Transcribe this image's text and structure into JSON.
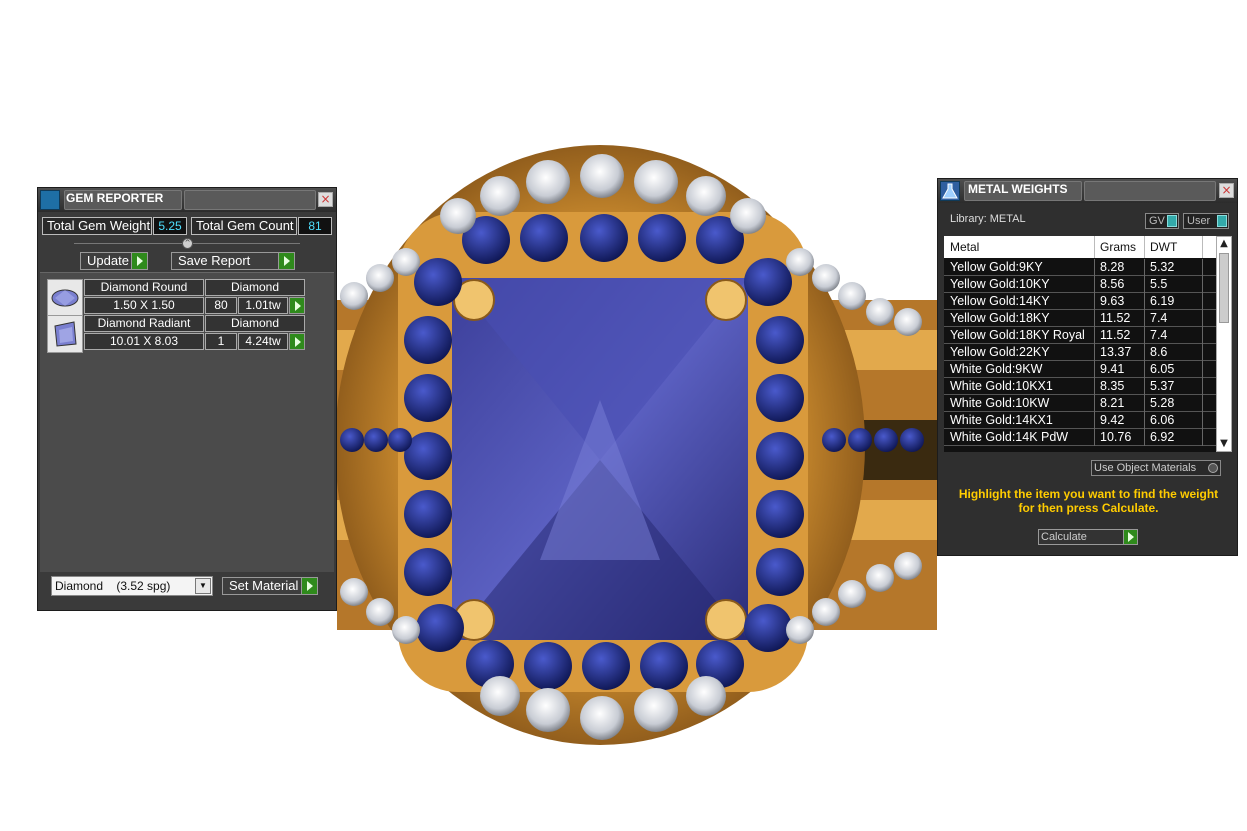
{
  "gem_reporter": {
    "title": "GEM REPORTER",
    "total_gem_weight_label": "Total Gem Weight",
    "total_gem_weight_value": "5.25",
    "total_gem_count_label": "Total Gem Count",
    "total_gem_count_value": "81",
    "update_label": "Update",
    "save_report_label": "Save Report",
    "gems": [
      {
        "name": "Diamond Round",
        "material": "Diamond",
        "size": "1.50 X 1.50",
        "count": "80",
        "weight": "1.01tw"
      },
      {
        "name": "Diamond Radiant",
        "material": "Diamond",
        "size": "10.01 X 8.03",
        "count": "1",
        "weight": "4.24tw"
      }
    ],
    "material_select_value": "Diamond    (3.52 spg)",
    "set_material_label": "Set Material"
  },
  "metal_weights": {
    "title": "METAL WEIGHTS",
    "library_label": "Library: METAL",
    "gv_toggle": "GV",
    "user_toggle": "User",
    "columns": [
      "Metal",
      "Grams",
      "DWT"
    ],
    "rows": [
      {
        "metal": "Yellow Gold:9KY",
        "grams": "8.28",
        "dwt": "5.32"
      },
      {
        "metal": "Yellow Gold:10KY",
        "grams": "8.56",
        "dwt": "5.5"
      },
      {
        "metal": "Yellow Gold:14KY",
        "grams": "9.63",
        "dwt": "6.19"
      },
      {
        "metal": "Yellow Gold:18KY",
        "grams": "11.52",
        "dwt": "7.4"
      },
      {
        "metal": "Yellow Gold:18KY Royal",
        "grams": "11.52",
        "dwt": "7.4"
      },
      {
        "metal": "Yellow Gold:22KY",
        "grams": "13.37",
        "dwt": "8.6"
      },
      {
        "metal": "White Gold:9KW",
        "grams": "9.41",
        "dwt": "6.05"
      },
      {
        "metal": "White Gold:10KX1",
        "grams": "8.35",
        "dwt": "5.37"
      },
      {
        "metal": "White Gold:10KW",
        "grams": "8.21",
        "dwt": "5.28"
      },
      {
        "metal": "White Gold:14KX1",
        "grams": "9.42",
        "dwt": "6.06"
      },
      {
        "metal": "White Gold:14K PdW",
        "grams": "10.76",
        "dwt": "6.92"
      }
    ],
    "use_object_materials_label": "Use Object Materials",
    "hint_line1": "Highlight the item you want to find the weight",
    "hint_line2": "for then press Calculate.",
    "calculate_label": "Calculate"
  }
}
